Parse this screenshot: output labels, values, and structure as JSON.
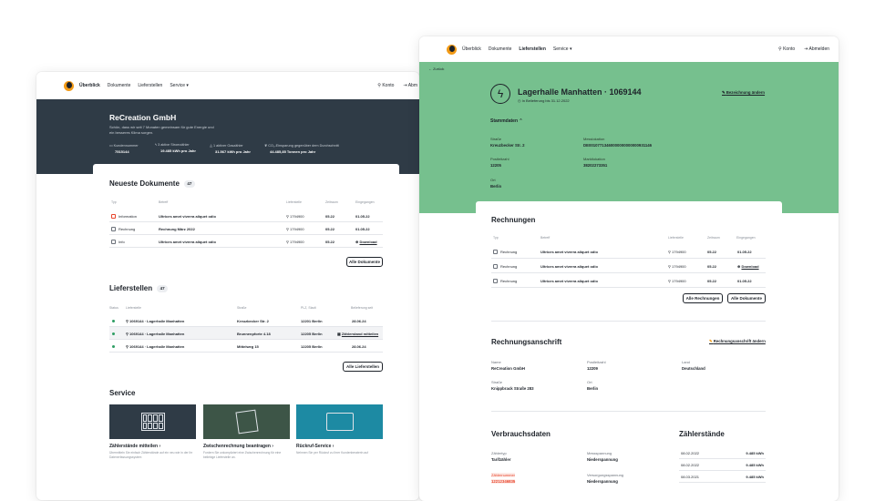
{
  "left": {
    "nav": {
      "items": [
        "Überblick",
        "Dokumente",
        "Lieferstellen",
        "Service ▾"
      ],
      "konto": "Konto",
      "abmelden": "Abm"
    },
    "hero": {
      "company": "ReCreation GmbH",
      "desc_line1": "Schön, dass wir seit 7 Monaten gemeinsam für gute Energie und",
      "desc_line2": "ein besseres Klima sorgen.",
      "stats": [
        {
          "label": "Kundennummer",
          "value": "7515144"
        },
        {
          "label": "3 aktive Stromzähler",
          "value": "19.485 kWh pro Jahr"
        },
        {
          "label": "1 aktiver Gaszähler",
          "value": "31.567 kWh pro Jahr"
        },
        {
          "label": "CO₂-Einsparung gegenüber dem Durchschnitt",
          "value": "44.485,85 Tonnen pro Jahr"
        }
      ]
    },
    "docs": {
      "title": "Neueste Dokumente",
      "count": "47",
      "headers": [
        "Typ",
        "Betreff",
        "Lieferstelle",
        "Zeitraum",
        "Eingegangen"
      ],
      "rows": [
        {
          "type": "Information",
          "subject": "Ultrices amet viverra aliquet odio",
          "ls": "1794900",
          "period": "05.22",
          "date": "01.05.22",
          "action": ""
        },
        {
          "type": "Rechnung",
          "subject": "Rechnung März 2022",
          "ls": "1794900",
          "period": "05.22",
          "date": "01.05.22",
          "action": ""
        },
        {
          "type": "Info",
          "subject": "Ultrices amet viverra aliquet odio",
          "ls": "1794900",
          "period": "05.22",
          "date": "",
          "action": "Download"
        }
      ],
      "all_button": "Alle Dokumente"
    },
    "ls": {
      "title": "Lieferstellen",
      "count": "47",
      "headers": [
        "Status",
        "Lieferstelle",
        "Straße",
        "PLZ, Stadt",
        "Belieferung seit"
      ],
      "rows": [
        {
          "name": "1069144 · Lagerhalle Manhatten",
          "street": "Kreuzbecker Str. 2",
          "city": "12201 Berlin",
          "since": "28.06.24",
          "action": ""
        },
        {
          "name": "1069144 · Lagerhalle Manhatten",
          "street": "Brunnenpforte 4.18",
          "city": "12205 Berlin",
          "since": "",
          "action": "Zählerstand mitteilen"
        },
        {
          "name": "1069144 · Lagerhalle Manhatten",
          "street": "Mittelweg 15",
          "city": "12205 Berlin",
          "since": "28.06.24",
          "action": ""
        }
      ],
      "all_button": "Alle Lieferstellen"
    },
    "service": {
      "title": "Service",
      "cards": [
        {
          "title": "Zählerstände mitteilen",
          "desc": "Übermitteln Sie einfach Zählerstände auf ein neu wie in der Ihr Datenerfassungssystem"
        },
        {
          "title": "Zwischenrechnung beantragen",
          "desc": "Fordern Sie unkompliziert eine Zwischenrechnung für eine beliebige Lieferstelle an."
        },
        {
          "title": "Rückruf-Service",
          "desc": "Nehmen Sie per Rückruf zu Ihrer Kundenberaterin auf"
        }
      ]
    }
  },
  "right": {
    "nav": {
      "items": [
        "Überblick",
        "Dokumente",
        "Lieferstellen",
        "Service ▾"
      ],
      "konto": "Konto",
      "abmelden": "Abmelden"
    },
    "back": "← Zurück",
    "title": "Lagerhalle Manhatten · 1069144",
    "subtitle": "In Belieferung bis 31.12.2022",
    "edit": "Bezeichnung ändern",
    "stamm": "Stammdaten ⌃",
    "fields": [
      {
        "label": "Straße",
        "value": "Kreuzbecker Str. 2"
      },
      {
        "label": "Messlokation",
        "value": "DE00107713460000000000000931146"
      },
      {
        "label": "Postleitzahl",
        "value": "12205"
      },
      {
        "label": "Marktlokation",
        "value": "38202273351"
      },
      {
        "label": "Ort",
        "value": "Berlin"
      }
    ],
    "rechnungen": {
      "title": "Rechnungen",
      "headers": [
        "Typ",
        "Betreff",
        "Lieferstelle",
        "Zeitraum",
        "Eingegangen"
      ],
      "rows": [
        {
          "type": "Rechnung",
          "subject": "Ultrices amet viverra aliquet odio",
          "ls": "1794900",
          "period": "05.22",
          "date": "01.05.22",
          "action": ""
        },
        {
          "type": "Rechnung",
          "subject": "Ultrices amet viverra aliquet odio",
          "ls": "1794900",
          "period": "05.22",
          "date": "",
          "action": "Download"
        },
        {
          "type": "Rechnung",
          "subject": "Ultrices amet viverra aliquet odio",
          "ls": "1794900",
          "period": "05.22",
          "date": "01.05.22",
          "action": ""
        }
      ],
      "btn1": "Alle Rechnungen",
      "btn2": "Alle Dokumente"
    },
    "anschrift": {
      "title": "Rechnungsanschrift",
      "edit": "Rechnungsanschrift ändern",
      "fields": [
        {
          "label": "Name",
          "value": "ReCreation GmbH"
        },
        {
          "label": "Postleitzahl",
          "value": "12209"
        },
        {
          "label": "Land",
          "value": "Deutschland"
        },
        {
          "label": "Straße",
          "value": "Knippbrack Straße 283"
        },
        {
          "label": "Ort",
          "value": "Berlin"
        }
      ]
    },
    "verbrauch": {
      "title": "Verbrauchsdaten",
      "fields": [
        {
          "label": "Zählertyp",
          "value": "Tarifzähler"
        },
        {
          "label": "Messspannung",
          "value": "Niederspannung"
        },
        {
          "label": "Zählernummer",
          "value": "12212346835"
        },
        {
          "label": "Versorgungsspannung",
          "value": "Niederspannung"
        }
      ]
    },
    "zaehler": {
      "title": "Zählerstände",
      "rows": [
        {
          "date": "08.02.2022",
          "value": "9.485 kWh"
        },
        {
          "date": "08.02.2022",
          "value": "9.485 kWh"
        },
        {
          "date": "08.03.2021",
          "value": "9.485 kWh"
        }
      ]
    }
  },
  "colors": {
    "green": "#76c08e",
    "dark": "#2f3b46",
    "accent": "#f29a16",
    "red": "#e8452c"
  }
}
